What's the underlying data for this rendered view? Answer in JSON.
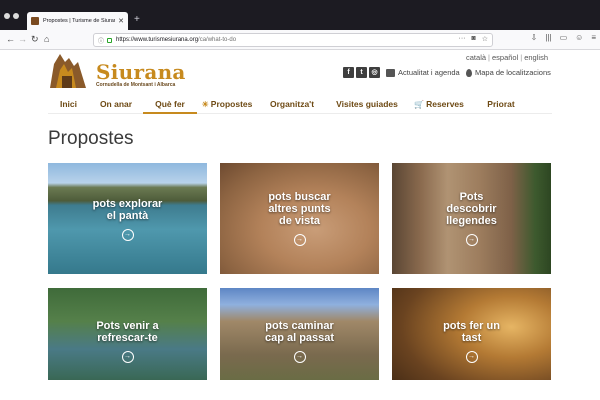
{
  "browser": {
    "tab_title": "Propostes | Turisme de Siurana",
    "tab_close": "✕",
    "new_tab": "+",
    "back": "←",
    "forward": "→",
    "reload": "↻",
    "home": "⌂",
    "url_domain": "https://www.turismesiurana.org",
    "url_path": "/ca/what-to-do",
    "url_more": "···",
    "tools": [
      "⇩",
      "|||",
      "▭",
      "☺",
      "≡"
    ]
  },
  "site": {
    "logo_name": "Siurana",
    "logo_sub": "Cornudella de Montsant i Albarca",
    "languages": [
      "català",
      "español",
      "english"
    ],
    "social": [
      "f",
      "t",
      "◎"
    ],
    "agenda": "Actualitat i agenda",
    "map": "Mapa de localitzacions",
    "menu": [
      {
        "label": "Inici",
        "icon": ""
      },
      {
        "label": "On anar",
        "icon": ""
      },
      {
        "label": "Què fer",
        "icon": ""
      },
      {
        "label": "Propostes",
        "icon": "☀"
      },
      {
        "label": "Organitza't",
        "icon": ""
      },
      {
        "label": "Visites guiades",
        "icon": ""
      },
      {
        "label": "Reserves",
        "icon": "🛒"
      },
      {
        "label": "Priorat",
        "icon": ""
      }
    ],
    "active_menu": "Què fer",
    "accent_color": "#c78a1e"
  },
  "page": {
    "title": "Propostes",
    "cards": [
      {
        "line1": "pots explorar",
        "line2": "el pantà",
        "line3": ""
      },
      {
        "line1": "pots buscar",
        "line2": "altres punts",
        "line3": "de vista"
      },
      {
        "line1": "Pots",
        "line2": "descobrir",
        "line3": "llegendes"
      },
      {
        "line1": "Pots venir a",
        "line2": "refrescar-te",
        "line3": ""
      },
      {
        "line1": "pots caminar",
        "line2": "cap al passat",
        "line3": ""
      },
      {
        "line1": "pots fer un",
        "line2": "tast",
        "line3": ""
      }
    ],
    "card_arrow": "→"
  }
}
